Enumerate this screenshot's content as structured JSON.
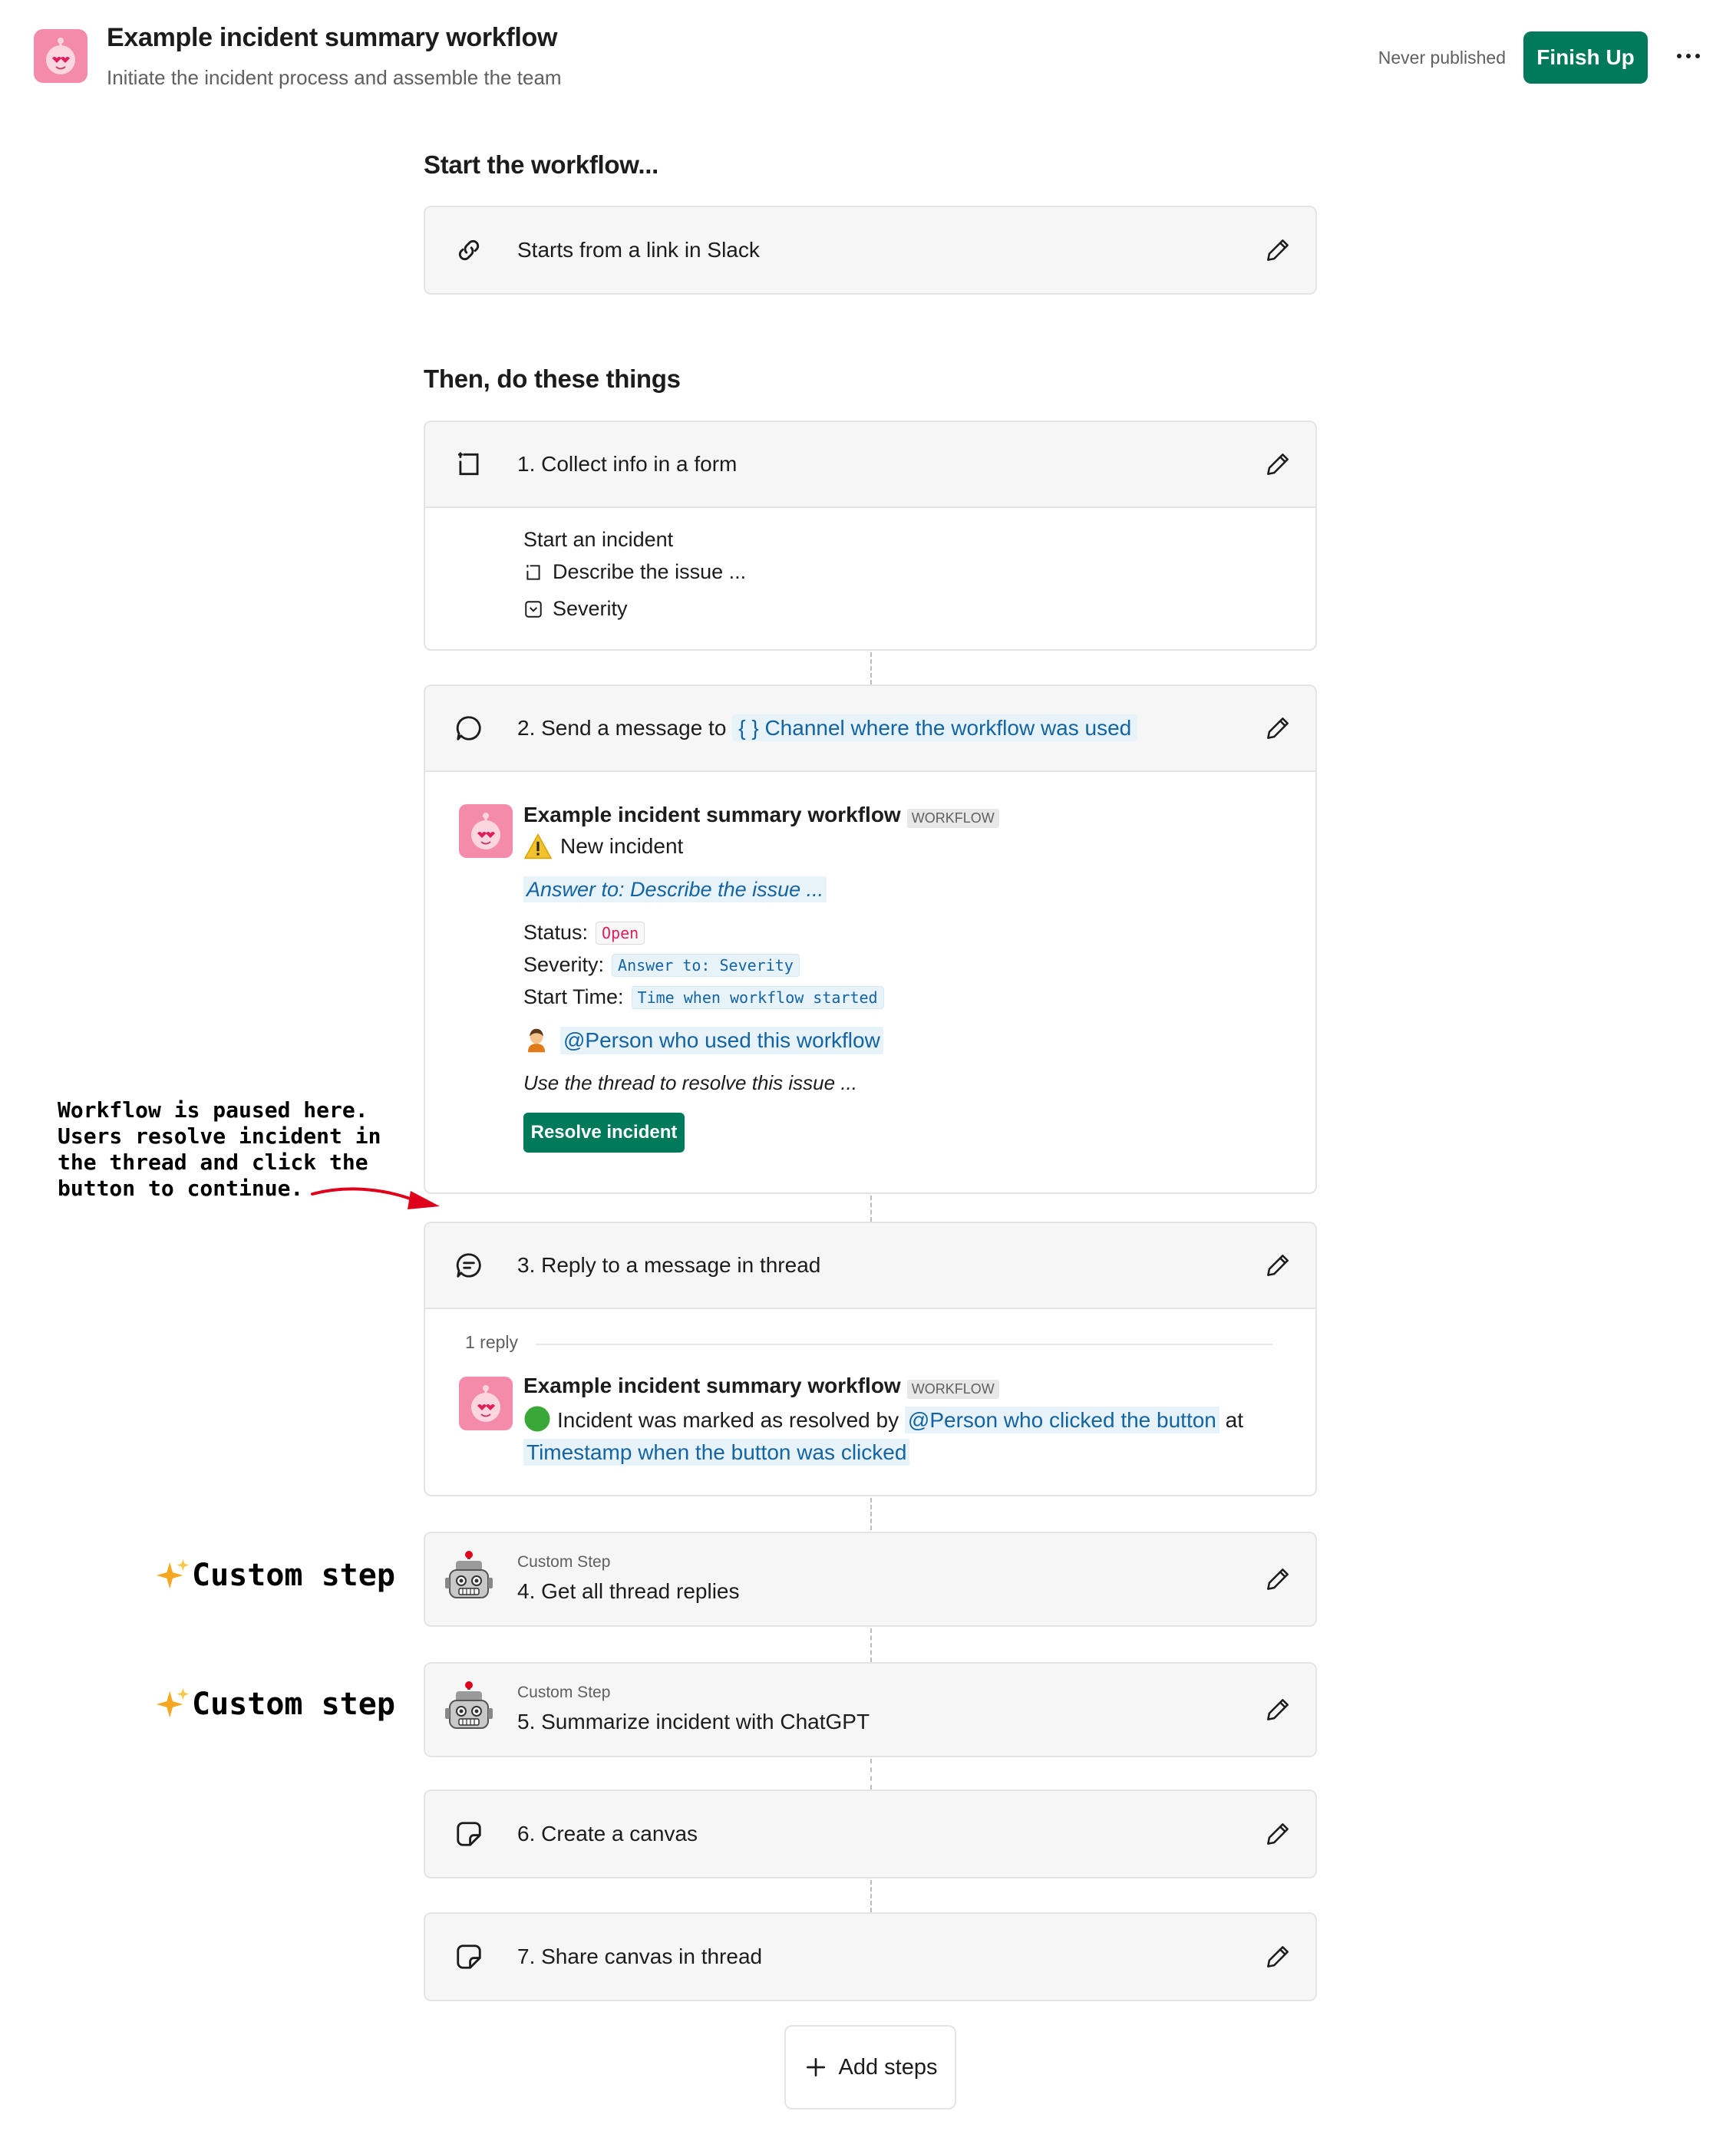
{
  "header": {
    "title": "Example incident summary workflow",
    "subtitle": "Initiate the incident process and assemble the team",
    "publish_status": "Never published",
    "finish_label": "Finish Up",
    "more_icon": "ellipsis-icon"
  },
  "start_section": {
    "heading": "Start the workflow...",
    "trigger_label": "Starts from a link in Slack",
    "trigger_icon": "link-icon"
  },
  "steps_section": {
    "heading": "Then, do these things"
  },
  "step1": {
    "label": "1. Collect info in a form",
    "icon": "form-icon",
    "form_title": "Start an incident",
    "fields": [
      {
        "label": "Describe the issue ...",
        "icon": "text-field-icon"
      },
      {
        "label": "Severity",
        "icon": "dropdown-field-icon"
      }
    ]
  },
  "step2": {
    "label_prefix": "2. Send a message to",
    "channel_token": "{ } Channel where the workflow was used",
    "icon": "message-icon",
    "message": {
      "bot_name": "Example incident summary workflow",
      "badge": "WORKFLOW",
      "headline": "New incident",
      "answer_link": "Answer to: Describe the issue ...",
      "status_label": "Status:",
      "status_value": "Open",
      "severity_label": "Severity:",
      "severity_value": "Answer to: Severity",
      "start_time_label": "Start Time:",
      "start_time_value": "Time when workflow started",
      "person_mention": "@Person who used this workflow",
      "instruction": "Use the thread to resolve this issue ...",
      "button_label": "Resolve incident"
    }
  },
  "step3": {
    "label": "3. Reply to a message in thread",
    "icon": "thread-reply-icon",
    "reply_count": "1 reply",
    "message": {
      "bot_name": "Example incident summary workflow",
      "badge": "WORKFLOW",
      "text_before": "Incident was marked as resolved by",
      "person_mention": "@Person who clicked the button",
      "text_at": "at",
      "timestamp_token": "Timestamp when the button was clicked"
    }
  },
  "step4": {
    "sub": "Custom Step",
    "label": "4. Get all thread replies",
    "icon": "robot-icon"
  },
  "step5": {
    "sub": "Custom Step",
    "label": "5. Summarize incident with ChatGPT",
    "icon": "robot-icon"
  },
  "step6": {
    "label": "6. Create a canvas",
    "icon": "canvas-icon"
  },
  "step7": {
    "label": "7. Share canvas in thread",
    "icon": "canvas-icon"
  },
  "add_steps_label": "Add steps",
  "annotations": {
    "paused_note": "Workflow is paused here.\nUsers resolve incident in\nthe thread and click the\nbutton to continue.",
    "custom_step_1": "Custom step",
    "custom_step_2": "Custom step"
  },
  "colors": {
    "primary_green": "#007a5a",
    "link_blue": "#1264a3",
    "chip_bg": "#e8f2f9",
    "logo_pink": "#f58bab",
    "arrow_red": "#e0001b"
  }
}
